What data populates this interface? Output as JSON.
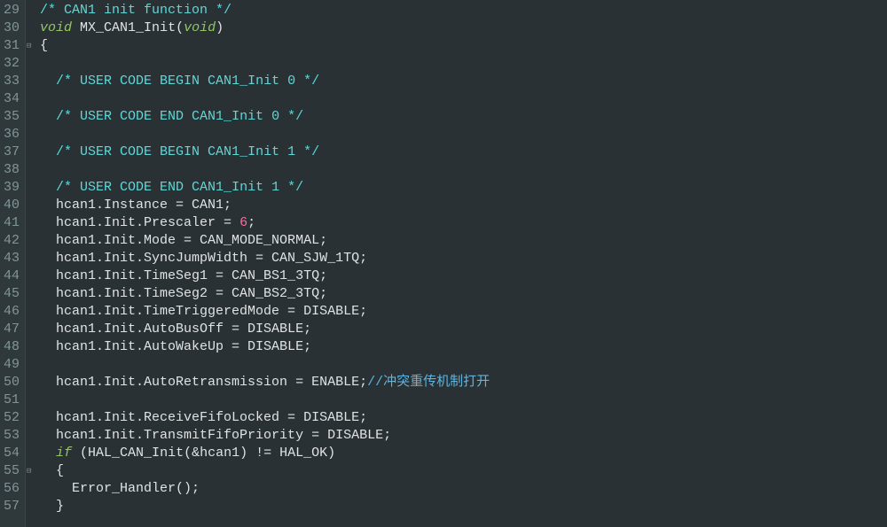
{
  "lines": [
    {
      "num": "29",
      "fold": "",
      "segs": [
        [
          "c-comment-block",
          "/* CAN1 init function */"
        ]
      ]
    },
    {
      "num": "30",
      "fold": "",
      "segs": [
        [
          "c-keyword",
          "void"
        ],
        [
          "c-punct",
          " "
        ],
        [
          "c-func",
          "MX_CAN1_Init"
        ],
        [
          "c-punct",
          "("
        ],
        [
          "c-keyword2",
          "void"
        ],
        [
          "c-punct",
          ")"
        ]
      ]
    },
    {
      "num": "31",
      "fold": "⊟",
      "segs": [
        [
          "c-punct",
          "{"
        ]
      ]
    },
    {
      "num": "32",
      "fold": "",
      "segs": [
        [
          "c-punct",
          ""
        ]
      ]
    },
    {
      "num": "33",
      "fold": "",
      "segs": [
        [
          "c-punct",
          "  "
        ],
        [
          "c-comment-block",
          "/* USER CODE BEGIN CAN1_Init 0 */"
        ]
      ]
    },
    {
      "num": "34",
      "fold": "",
      "segs": [
        [
          "c-punct",
          ""
        ]
      ]
    },
    {
      "num": "35",
      "fold": "",
      "segs": [
        [
          "c-punct",
          "  "
        ],
        [
          "c-comment-block",
          "/* USER CODE END CAN1_Init 0 */"
        ]
      ]
    },
    {
      "num": "36",
      "fold": "",
      "segs": [
        [
          "c-punct",
          ""
        ]
      ]
    },
    {
      "num": "37",
      "fold": "",
      "segs": [
        [
          "c-punct",
          "  "
        ],
        [
          "c-comment-block",
          "/* USER CODE BEGIN CAN1_Init 1 */"
        ]
      ]
    },
    {
      "num": "38",
      "fold": "",
      "segs": [
        [
          "c-punct",
          ""
        ]
      ]
    },
    {
      "num": "39",
      "fold": "",
      "segs": [
        [
          "c-punct",
          "  "
        ],
        [
          "c-comment-block",
          "/* USER CODE END CAN1_Init 1 */"
        ]
      ]
    },
    {
      "num": "40",
      "fold": "",
      "segs": [
        [
          "c-punct",
          "  hcan1.Instance = CAN1;"
        ]
      ]
    },
    {
      "num": "41",
      "fold": "",
      "segs": [
        [
          "c-punct",
          "  hcan1.Init.Prescaler = "
        ],
        [
          "c-number",
          "6"
        ],
        [
          "c-punct",
          ";"
        ]
      ]
    },
    {
      "num": "42",
      "fold": "",
      "segs": [
        [
          "c-punct",
          "  hcan1.Init.Mode = CAN_MODE_NORMAL;"
        ]
      ]
    },
    {
      "num": "43",
      "fold": "",
      "segs": [
        [
          "c-punct",
          "  hcan1.Init.SyncJumpWidth = CAN_SJW_1TQ;"
        ]
      ]
    },
    {
      "num": "44",
      "fold": "",
      "segs": [
        [
          "c-punct",
          "  hcan1.Init.TimeSeg1 = CAN_BS1_3TQ;"
        ]
      ]
    },
    {
      "num": "45",
      "fold": "",
      "segs": [
        [
          "c-punct",
          "  hcan1.Init.TimeSeg2 = CAN_BS2_3TQ;"
        ]
      ]
    },
    {
      "num": "46",
      "fold": "",
      "segs": [
        [
          "c-punct",
          "  hcan1.Init.TimeTriggeredMode = DISABLE;"
        ]
      ]
    },
    {
      "num": "47",
      "fold": "",
      "segs": [
        [
          "c-punct",
          "  hcan1.Init.AutoBusOff = DISABLE;"
        ]
      ]
    },
    {
      "num": "48",
      "fold": "",
      "segs": [
        [
          "c-punct",
          "  hcan1.Init.AutoWakeUp = DISABLE;"
        ]
      ]
    },
    {
      "num": "49",
      "fold": "",
      "segs": [
        [
          "c-punct",
          ""
        ]
      ]
    },
    {
      "num": "50",
      "fold": "",
      "segs": [
        [
          "c-punct",
          "  hcan1.Init.AutoRetransmission = ENABLE;"
        ],
        [
          "c-cn-comment",
          "//冲突重传机制打开"
        ]
      ]
    },
    {
      "num": "51",
      "fold": "",
      "segs": [
        [
          "c-punct",
          ""
        ]
      ]
    },
    {
      "num": "52",
      "fold": "",
      "segs": [
        [
          "c-punct",
          "  hcan1.Init.ReceiveFifoLocked = DISABLE;"
        ]
      ]
    },
    {
      "num": "53",
      "fold": "",
      "segs": [
        [
          "c-punct",
          "  hcan1.Init.TransmitFifoPriority = DISABLE;"
        ]
      ]
    },
    {
      "num": "54",
      "fold": "",
      "segs": [
        [
          "c-punct",
          "  "
        ],
        [
          "c-keyword",
          "if"
        ],
        [
          "c-punct",
          " (HAL_CAN_Init(&hcan1) != HAL_OK)"
        ]
      ]
    },
    {
      "num": "55",
      "fold": "⊟",
      "segs": [
        [
          "c-punct",
          "  {"
        ]
      ]
    },
    {
      "num": "56",
      "fold": "",
      "segs": [
        [
          "c-punct",
          "    Error_Handler();"
        ]
      ]
    },
    {
      "num": "57",
      "fold": "",
      "segs": [
        [
          "c-punct",
          "  }"
        ]
      ]
    }
  ]
}
